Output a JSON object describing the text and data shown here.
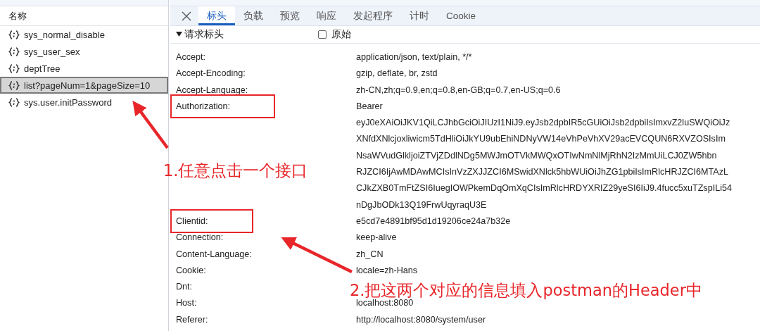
{
  "sidebar": {
    "header": "名称",
    "items": [
      {
        "label": "sys_normal_disable",
        "selected": false
      },
      {
        "label": "sys_user_sex",
        "selected": false
      },
      {
        "label": "deptTree",
        "selected": false
      },
      {
        "label": "list?pageNum=1&pageSize=10",
        "selected": true
      },
      {
        "label": "sys.user.initPassword",
        "selected": false
      }
    ]
  },
  "tabs": [
    {
      "label": "标头",
      "selected": true
    },
    {
      "label": "负载",
      "selected": false
    },
    {
      "label": "预览",
      "selected": false
    },
    {
      "label": "响应",
      "selected": false
    },
    {
      "label": "发起程序",
      "selected": false
    },
    {
      "label": "计时",
      "selected": false
    },
    {
      "label": "Cookie",
      "selected": false
    }
  ],
  "section": {
    "title": "请求标头",
    "expanded": true,
    "raw": {
      "label": "原始",
      "checked": false
    }
  },
  "headers": [
    {
      "name": "Accept:",
      "boxed": false,
      "value": [
        "application/json, text/plain, */*"
      ]
    },
    {
      "name": "Accept-Encoding:",
      "boxed": false,
      "value": [
        "gzip, deflate, br, zstd"
      ]
    },
    {
      "name": "Accept-Language:",
      "boxed": false,
      "value": [
        "zh-CN,zh;q=0.9,en;q=0.8,en-GB;q=0.7,en-US;q=0.6"
      ]
    },
    {
      "name": "Authorization:",
      "boxed": true,
      "value": [
        "Bearer",
        "eyJ0eXAiOiJKV1QiLCJhbGciOiJIUzI1NiJ9.eyJsb2dpbIR5cGUiOiJsb2dpbiIsImxvZ2luSWQiOiJz",
        "XNfdXNlcjoxliwicm5TdHliOiJkYU9ubEhiNDNyVW14eVhPeVhXV29acEVCQUN6RXVZOSIsIm",
        "NsaWVudGlkljoiZTVjZDdlNDg5MWJmOTVkMWQxOTIwNmNlMjRhN2IzMmUiLCJ0ZW5hbn",
        "RJZCI6IjAwMDAwMCIsInVzZXJJZCI6MSwidXNlck5hbWUiOiJhZG1pbiIsImRlcHRJZCI6MTAzL",
        "CJkZXB0TmFtZSI6IuegIOWPkemDqOmXqCIsImRlcHRDYXRIZ29yeSI6IiJ9.4fucc5xuTZspILi54",
        "nDgJbODk13Q19FrwUqyraqU3E"
      ]
    },
    {
      "name": "Clientid:",
      "boxed": true,
      "value": [
        "e5cd7e4891bf95d1d19206ce24a7b32e"
      ]
    },
    {
      "name": "Connection:",
      "boxed": false,
      "value": [
        "keep-alive"
      ]
    },
    {
      "name": "Content-Language:",
      "boxed": false,
      "value": [
        "zh_CN"
      ]
    },
    {
      "name": "Cookie:",
      "boxed": false,
      "value": [
        "locale=zh-Hans"
      ]
    },
    {
      "name": "Dnt:",
      "boxed": false
    },
    {
      "name": "Host:",
      "boxed": false,
      "value": [
        "localhost:8080"
      ]
    },
    {
      "name": "Referer:",
      "boxed": false,
      "value": [
        "http://localhost:8080/system/user"
      ]
    }
  ],
  "annotations": [
    "1.任意点击一个接口",
    "2.把这两个对应的信息填入postman的Header中"
  ]
}
